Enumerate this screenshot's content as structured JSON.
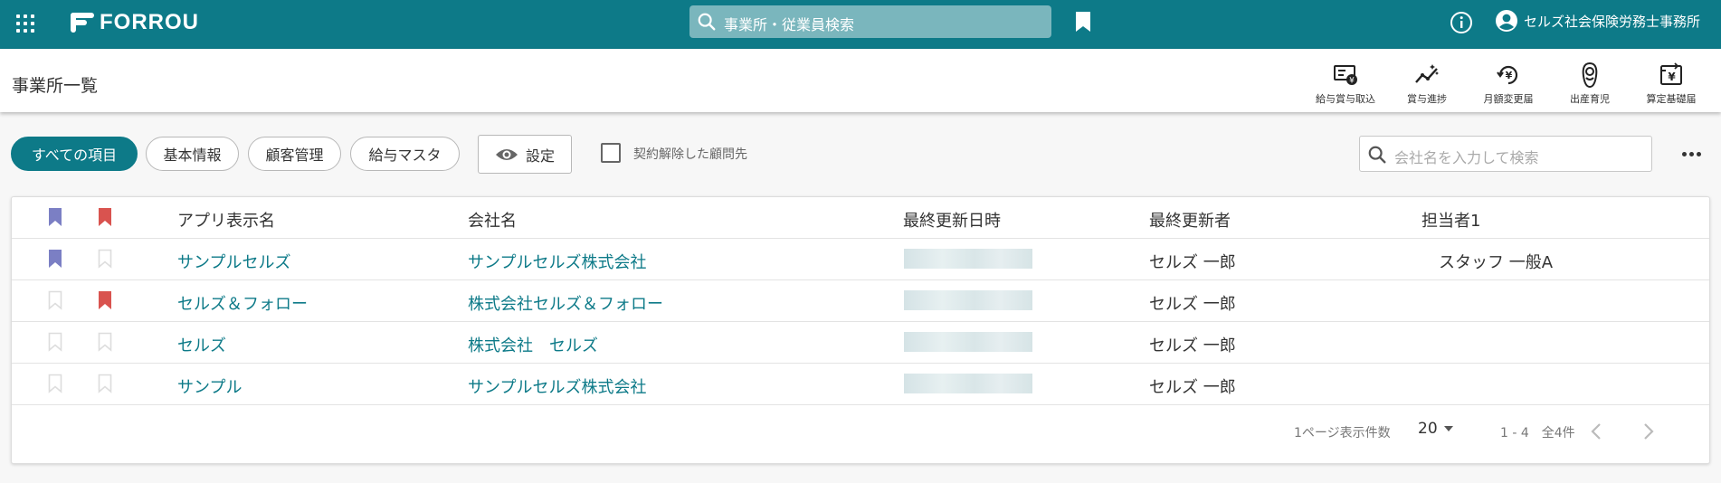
{
  "header": {
    "logo_text": "FORROU",
    "search_placeholder": "事業所・従業員検索",
    "user_name": "セルズ社会保険労務士事務所",
    "brand_color": "#0d7a88"
  },
  "subheader": {
    "title": "事業所一覧",
    "tools": [
      {
        "label": "給与賞与取込",
        "icon": "salary-import-icon"
      },
      {
        "label": "賞与進捗",
        "icon": "bonus-progress-icon"
      },
      {
        "label": "月額変更届",
        "icon": "monthly-change-icon"
      },
      {
        "label": "出産育児",
        "icon": "childbirth-icon"
      },
      {
        "label": "算定基礎届",
        "icon": "calculation-base-icon"
      }
    ]
  },
  "filters": {
    "chips": [
      "すべての項目",
      "基本情報",
      "顧客管理",
      "給与マスタ"
    ],
    "active_chip": "すべての項目",
    "settings_label": "設定",
    "checkbox_label": "契約解除した顧問先",
    "checkbox_checked": false,
    "search_placeholder": "会社名を入力して検索"
  },
  "table": {
    "columns": [
      "アプリ表示名",
      "会社名",
      "最終更新日時",
      "最終更新者",
      "担当者1"
    ],
    "rows": [
      {
        "app_name": "サンプルセルズ",
        "company": "サンプルセルズ株式会社",
        "updated_at": "",
        "updated_by": "セルズ 一郎",
        "person": "スタッフ 一般A",
        "bookmark_purple": true,
        "bookmark_red": false
      },
      {
        "app_name": "セルズ＆フォロー",
        "company": "株式会社セルズ＆フォロー",
        "updated_at": "",
        "updated_by": "セルズ 一郎",
        "person": "",
        "bookmark_purple": false,
        "bookmark_red": true
      },
      {
        "app_name": "セルズ",
        "company": "株式会社　セルズ",
        "updated_at": "",
        "updated_by": "セルズ 一郎",
        "person": "",
        "bookmark_purple": false,
        "bookmark_red": false
      },
      {
        "app_name": "サンプル",
        "company": "サンプルセルズ株式会社",
        "updated_at": "",
        "updated_by": "セルズ 一郎",
        "person": "",
        "bookmark_purple": false,
        "bookmark_red": false
      }
    ],
    "bookmark_colors": {
      "purple": "#7b7fc4",
      "red": "#d9534f",
      "empty": "#dddddd"
    }
  },
  "pagination": {
    "rows_per_page_label": "1ページ表示件数",
    "rows_per_page": "20",
    "range_label": "1 - 4　全4件"
  }
}
